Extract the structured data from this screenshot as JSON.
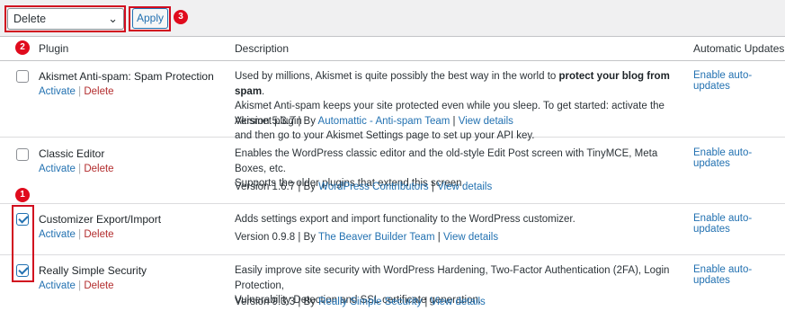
{
  "toolbar": {
    "bulk_action_selected": "Delete",
    "apply_label": "Apply"
  },
  "annotations": {
    "badge1": "1",
    "badge2": "2",
    "badge3": "3"
  },
  "table": {
    "headers": {
      "plugin": "Plugin",
      "description": "Description",
      "auto_updates": "Automatic Updates"
    },
    "action_labels": {
      "activate": "Activate",
      "separator": "|",
      "delete": "Delete",
      "enable_auto": "Enable auto-updates"
    },
    "plugins": [
      {
        "name": "Akismet Anti-spam: Spam Protection",
        "checked": false,
        "desc_line1_pre": "Used by millions, Akismet is quite possibly the best way in the world to ",
        "desc_line1_bold": "protect your blog from spam",
        "desc_line1_post": ".",
        "desc_line2": "Akismet Anti-spam keeps your site protected even while you sleep. To get started: activate the Akismet plugin",
        "desc_line3": "and then go to your Akismet Settings page to set up your API key.",
        "version": "Version 5.3.7",
        "by": "By",
        "author": "Automattic - Anti-spam Team",
        "view_details": "View details"
      },
      {
        "name": "Classic Editor",
        "checked": false,
        "desc_line1": "Enables the WordPress classic editor and the old-style Edit Post screen with TinyMCE, Meta Boxes, etc.",
        "desc_line2": "Supports the older plugins that extend this screen.",
        "version": "Version 1.6.7",
        "by": "By",
        "author": "WordPress Contributors",
        "view_details": "View details"
      },
      {
        "name": "Customizer Export/Import",
        "checked": true,
        "desc_line1": "Adds settings export and import functionality to the WordPress customizer.",
        "version": "Version 0.9.8",
        "by": "By",
        "author": "The Beaver Builder Team",
        "view_details": "View details"
      },
      {
        "name": "Really Simple Security",
        "checked": true,
        "desc_line1": "Easily improve site security with WordPress Hardening, Two-Factor Authentication (2FA), Login Protection,",
        "desc_line2": "Vulnerability Detection and SSL certificate generation.",
        "version": "Version 9.3.3",
        "by": "By",
        "author": "Really Simple Security",
        "view_details": "View details"
      }
    ]
  },
  "colors": {
    "annotation_red": "#d10d1f",
    "link_blue": "#2271b1",
    "delete_red": "#b32d2e"
  }
}
